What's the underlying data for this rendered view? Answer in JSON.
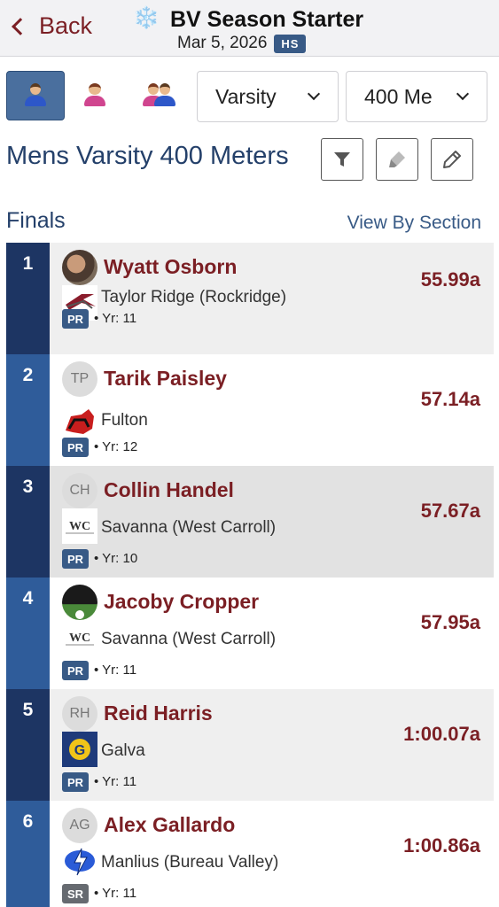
{
  "header": {
    "back_label": "Back",
    "snow_glyph": "❄️",
    "title": "BV Season Starter",
    "date": "Mar 5, 2026",
    "level_badge": "HS"
  },
  "filters": {
    "gender_buttons": [
      "male-icon",
      "female-icon",
      "mixed-icon"
    ],
    "selected_gender": "male-icon",
    "division": "Varsity",
    "event": "400 Me"
  },
  "event": {
    "title": "Mens Varsity 400 Meters",
    "tools": [
      "filter-icon",
      "highlighter-icon",
      "edit-icon"
    ]
  },
  "section": {
    "label": "Finals",
    "view_by": "View By Section"
  },
  "colors": {
    "maroon": "#7b1f24",
    "navy": "#1d3563",
    "blue": "#2f5c9a",
    "badge": "#385a86"
  },
  "results": [
    {
      "place": "1",
      "name": "Wyatt Osborn",
      "initials": "",
      "school": "Taylor Ridge (Rockridge)",
      "badge": "PR",
      "year": "Yr: 11",
      "mark": "55.99a"
    },
    {
      "place": "2",
      "name": "Tarik Paisley",
      "initials": "TP",
      "school": "Fulton",
      "badge": "PR",
      "year": "Yr: 12",
      "mark": "57.14a"
    },
    {
      "place": "3",
      "name": "Collin Handel",
      "initials": "CH",
      "school": "Savanna (West Carroll)",
      "badge": "PR",
      "year": "Yr: 10",
      "mark": "57.67a"
    },
    {
      "place": "4",
      "name": "Jacoby Cropper",
      "initials": "",
      "school": "Savanna (West Carroll)",
      "badge": "PR",
      "year": "Yr: 11",
      "mark": "57.95a"
    },
    {
      "place": "5",
      "name": "Reid Harris",
      "initials": "RH",
      "school": "Galva",
      "badge": "PR",
      "year": "Yr: 11",
      "mark": "1:00.07a"
    },
    {
      "place": "6",
      "name": "Alex Gallardo",
      "initials": "AG",
      "school": "Manlius (Bureau Valley)",
      "badge": "SR",
      "year": "Yr: 11",
      "mark": "1:00.86a"
    }
  ]
}
